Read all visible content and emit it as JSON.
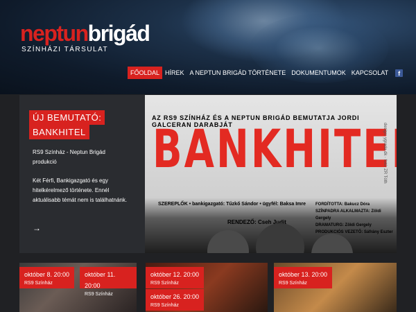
{
  "header": {
    "logo_part1": "neptun",
    "logo_part2": "brigád",
    "subtitle": "SZÍNHÁZI TÁRSULAT"
  },
  "nav": {
    "items": [
      {
        "label": "FŐOLDAL",
        "active": true
      },
      {
        "label": "HÍREK",
        "active": false
      },
      {
        "label": "A NEPTUN BRIGÁD TÖRTÉNETE",
        "active": false
      },
      {
        "label": "DOKUMENTUMOK",
        "active": false
      },
      {
        "label": "KAPCSOLAT",
        "active": false
      }
    ],
    "facebook_icon": "f"
  },
  "featured": {
    "tag_line1": "ÚJ BEMUTATÓ:",
    "tag_line2": "BANKHITEL",
    "production": "RS9 Színház - Neptun Brigád produkció",
    "description": "Két Férfi, Bankigazgató és egy hitelkérelmező története. Ennél aktuálisabb témát nem is találhatnánk.",
    "arrow": "→"
  },
  "poster": {
    "top": "AZ RS9 SZÍNHÁZ ÉS A NEPTUN BRIGÁD BEMUTATJA JORDI GALCERAN DARABJÁT",
    "title": "BANKHITEL",
    "cast": "SZEREPLŐK • bankigazgató: Tűzkő Sándor • ügyfél: Baksa Imre",
    "director": "RENDEZŐ: Cseh Judit",
    "credits": [
      "FORDÍTOTTA: Bakucz Dóra",
      "SZÍNPADRA ALKALMAZTA: Zöldi Gergely",
      "DRAMATURG: Zöldi Gergely",
      "PRODUKCIÓS VEZETŐ: Sáfrány Eszter"
    ],
    "side": "design: ygrada.dk · fotó: ZR Tóth"
  },
  "events": [
    {
      "date": "október 8. 20:00",
      "venue": "RS9 Színház"
    },
    {
      "date": "október 11. 20:00",
      "venue": "RS9 Színház"
    },
    {
      "date": "október 12. 20:00",
      "venue": "RS9 Színház"
    },
    {
      "date": "október 26. 20:00",
      "venue": "RS9 Színház"
    },
    {
      "date": "október 13. 20:00",
      "venue": "RS9 Színház"
    }
  ],
  "colors": {
    "accent": "#d8221f",
    "background": "#202124",
    "facebook": "#3b5998"
  }
}
